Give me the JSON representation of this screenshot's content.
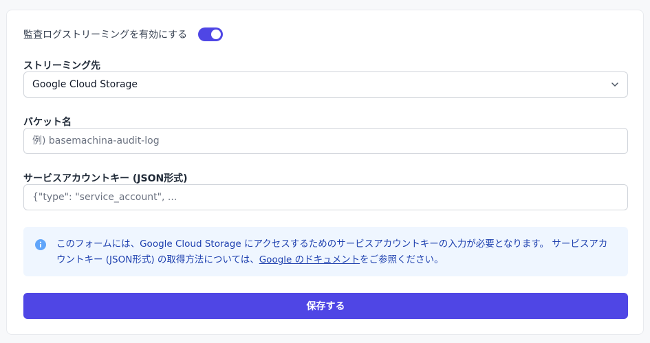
{
  "streaming": {
    "toggle_label": "監査ログストリーミングを有効にする",
    "enabled": true,
    "toggle_color": "#4f46e5"
  },
  "destination": {
    "label": "ストリーミング先",
    "selected": "Google Cloud Storage"
  },
  "bucket": {
    "label": "バケット名",
    "placeholder": "例) basemachina-audit-log",
    "value": ""
  },
  "service_account": {
    "label": "サービスアカウントキー (JSON形式)",
    "placeholder": "{\"type\": \"service_account\", ...",
    "value": ""
  },
  "info": {
    "text_before": "このフォームには、Google Cloud Storage にアクセスするためのサービスアカウントキーの入力が必要となります。 サービスアカウントキー (JSON形式) の取得方法については、",
    "link_text": "Google のドキュメント",
    "text_after": "をご参照ください。",
    "icon": "info-circle-icon"
  },
  "actions": {
    "save_label": "保存する",
    "primary_color": "#4f46e5"
  }
}
